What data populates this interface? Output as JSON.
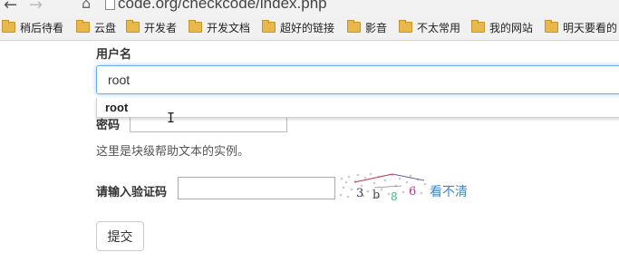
{
  "browser": {
    "url": "code.org/checkcode/index.php",
    "nav_icons": [
      "back-arrow-icon",
      "forward-arrow-icon",
      "home-icon",
      "document-icon"
    ]
  },
  "bookmarks": [
    {
      "label": "稍后待看"
    },
    {
      "label": "云盘"
    },
    {
      "label": "开发者"
    },
    {
      "label": "开发文档"
    },
    {
      "label": "超好的链接"
    },
    {
      "label": "影音"
    },
    {
      "label": "不太常用"
    },
    {
      "label": "我的网站"
    },
    {
      "label": "明天要看的"
    }
  ],
  "form": {
    "username_label": "用户名",
    "username_value": "root",
    "autocomplete_suggestion": "root",
    "password_label": "密码",
    "help_text": "这里是块级帮助文本的实例。",
    "code_label": "请输入验证码",
    "code_value": "",
    "captcha_text": "3 b 8 6",
    "refresh_link": "看不清",
    "submit_label": "提交"
  },
  "colors": {
    "focus_border": "#66afe9",
    "link": "#3d87c6",
    "folder": "#e8b84a"
  }
}
